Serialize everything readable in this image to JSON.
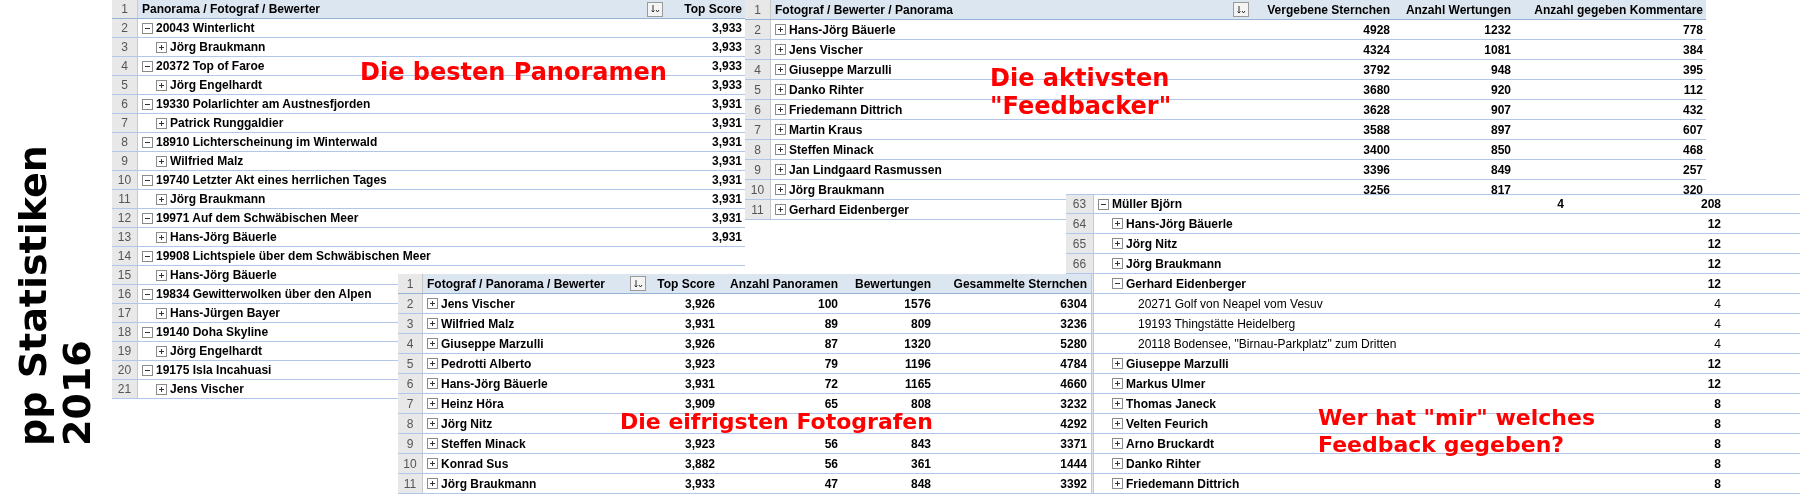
{
  "title": {
    "line_1": "pp Statistiken",
    "line_2": "2016"
  },
  "panorama_table": {
    "header_number": "1",
    "columns": [
      "Panorama / Fotograf / Bewerter",
      "Top Score"
    ],
    "rows": [
      {
        "number": "2",
        "label": "20043 Winterlicht",
        "expanded": true,
        "top_score": "3,933",
        "children": [
          {
            "number": "3",
            "label": "Jörg Braukmann",
            "expanded": false,
            "top_score": "3,933"
          }
        ]
      },
      {
        "number": "4",
        "label": "20372 Top of Faroe",
        "expanded": true,
        "top_score": "3,933",
        "children": [
          {
            "number": "5",
            "label": "Jörg Engelhardt",
            "expanded": false,
            "top_score": "3,933"
          }
        ]
      },
      {
        "number": "6",
        "label": "19330 Polarlichter am Austnesfjorden",
        "expanded": true,
        "top_score": "3,931",
        "children": [
          {
            "number": "7",
            "label": "Patrick Runggaldier",
            "expanded": false,
            "top_score": "3,931"
          }
        ]
      },
      {
        "number": "8",
        "label": "18910 Lichterscheinung im Winterwald",
        "expanded": true,
        "top_score": "3,931",
        "children": [
          {
            "number": "9",
            "label": "Wilfried Malz",
            "expanded": false,
            "top_score": "3,931"
          }
        ]
      },
      {
        "number": "10",
        "label": "19740 Letzter Akt eines herrlichen Tages",
        "expanded": true,
        "top_score": "3,931",
        "children": [
          {
            "number": "11",
            "label": "Jörg Braukmann",
            "expanded": false,
            "top_score": "3,931"
          }
        ]
      },
      {
        "number": "12",
        "label": "19971 Auf dem Schwäbischen Meer",
        "expanded": true,
        "top_score": "3,931",
        "children": [
          {
            "number": "13",
            "label": "Hans-Jörg Bäuerle",
            "expanded": false,
            "top_score": "3,931"
          }
        ]
      },
      {
        "number": "14",
        "label": "19908 Lichtspiele über dem Schwäbischen Meer",
        "expanded": true,
        "children": [
          {
            "number": "15",
            "label": "Hans-Jörg Bäuerle",
            "expanded": false
          }
        ]
      },
      {
        "number": "16",
        "label": "19834 Gewitterwolken über den Alpen",
        "expanded": true,
        "children": [
          {
            "number": "17",
            "label": "Hans-Jürgen Bayer",
            "expanded": false
          }
        ]
      },
      {
        "number": "18",
        "label": "19140 Doha Skyline",
        "expanded": true,
        "children": [
          {
            "number": "19",
            "label": "Jörg Engelhardt",
            "expanded": false
          }
        ]
      },
      {
        "number": "20",
        "label": "19175 Isla Incahuasi",
        "expanded": true,
        "children": [
          {
            "number": "21",
            "label": "Jens Vischer",
            "expanded": false
          }
        ]
      }
    ]
  },
  "feedbacker_table": {
    "header_number": "1",
    "columns": [
      "Fotograf / Bewerter / Panorama",
      "Vergebene Sternchen",
      "Anzahl Wertungen",
      "Anzahl gegeben Kommentare"
    ],
    "rows": [
      {
        "number": "2",
        "label": "Hans-Jörg Bäuerle",
        "expanded": false,
        "stars": "4928",
        "ratings": "1232",
        "comments": "778"
      },
      {
        "number": "3",
        "label": "Jens Vischer",
        "expanded": false,
        "stars": "4324",
        "ratings": "1081",
        "comments": "384"
      },
      {
        "number": "4",
        "label": "Giuseppe Marzulli",
        "expanded": false,
        "stars": "3792",
        "ratings": "948",
        "comments": "395"
      },
      {
        "number": "5",
        "label": "Danko Rihter",
        "expanded": false,
        "stars": "3680",
        "ratings": "920",
        "comments": "112"
      },
      {
        "number": "6",
        "label": "Friedemann Dittrich",
        "expanded": false,
        "stars": "3628",
        "ratings": "907",
        "comments": "432"
      },
      {
        "number": "7",
        "label": "Martin Kraus",
        "expanded": false,
        "stars": "3588",
        "ratings": "897",
        "comments": "607"
      },
      {
        "number": "8",
        "label": "Steffen Minack",
        "expanded": false,
        "stars": "3400",
        "ratings": "850",
        "comments": "468"
      },
      {
        "number": "9",
        "label": "Jan Lindgaard Rasmussen",
        "expanded": false,
        "stars": "3396",
        "ratings": "849",
        "comments": "257"
      },
      {
        "number": "10",
        "label": "Jörg Braukmann",
        "expanded": false,
        "stars": "3256",
        "ratings": "817",
        "comments": "320"
      },
      {
        "number": "11",
        "label": "Gerhard Eidenberger",
        "expanded": false
      }
    ]
  },
  "feedback_table": {
    "rows": [
      {
        "number": "63",
        "label": "Müller Björn",
        "expanded": true,
        "column_1": "4",
        "column_2": "208",
        "children": [
          {
            "number": "64",
            "label": "Hans-Jörg Bäuerle",
            "expanded": false,
            "column_2": "12"
          },
          {
            "number": "65",
            "label": "Jörg Nitz",
            "expanded": false,
            "column_2": "12"
          },
          {
            "number": "66",
            "label": "Jörg Braukmann",
            "expanded": false,
            "column_2": "12"
          },
          {
            "label": "Gerhard Eidenberger",
            "expanded": true,
            "column_2": "12",
            "children": [
              {
                "label": "20271 Golf von Neapel vom Vesuv",
                "column_2": "4"
              },
              {
                "label": "19193 Thingstätte Heidelberg",
                "column_2": "4"
              },
              {
                "label": "20118 Bodensee, \"Birnau-Parkplatz\" zum Dritten",
                "column_2": "4"
              }
            ]
          },
          {
            "label": "Giuseppe Marzulli",
            "expanded": false,
            "column_2": "12"
          },
          {
            "label": "Markus Ulmer",
            "expanded": false,
            "column_2": "12"
          },
          {
            "label": "Thomas Janeck",
            "expanded": false,
            "column_2": "8"
          },
          {
            "label": "Velten Feurich",
            "expanded": false,
            "column_2": "8"
          },
          {
            "label": "Arno Bruckardt",
            "expanded": false,
            "column_2": "8"
          },
          {
            "label": "Danko Rihter",
            "expanded": false,
            "column_2": "8"
          },
          {
            "label": "Friedemann Dittrich",
            "expanded": false,
            "column_2": "8"
          }
        ]
      }
    ]
  },
  "photographer_table": {
    "header_number": "1",
    "columns": [
      "Fotograf / Panorama / Bewerter",
      "Top Score",
      "Anzahl Panoramen",
      "Bewertungen",
      "Gesammelte Sternchen"
    ],
    "rows": [
      {
        "number": "2",
        "label": "Jens Vischer",
        "expanded": false,
        "top_score": "3,926",
        "panoramas": "100",
        "ratings": "1576",
        "stars": "6304"
      },
      {
        "number": "3",
        "label": "Wilfried Malz",
        "expanded": false,
        "top_score": "3,931",
        "panoramas": "89",
        "ratings": "809",
        "stars": "3236"
      },
      {
        "number": "4",
        "label": "Giuseppe Marzulli",
        "expanded": false,
        "top_score": "3,926",
        "panoramas": "87",
        "ratings": "1320",
        "stars": "5280"
      },
      {
        "number": "5",
        "label": "Pedrotti Alberto",
        "expanded": false,
        "top_score": "3,923",
        "panoramas": "79",
        "ratings": "1196",
        "stars": "4784"
      },
      {
        "number": "6",
        "label": "Hans-Jörg Bäuerle",
        "expanded": false,
        "top_score": "3,931",
        "panoramas": "72",
        "ratings": "1165",
        "stars": "4660"
      },
      {
        "number": "7",
        "label": "Heinz Höra",
        "expanded": false,
        "top_score": "3,909",
        "panoramas": "65",
        "ratings": "808",
        "stars": "3232"
      },
      {
        "number": "8",
        "label": "Jörg Nitz",
        "expanded": false,
        "stars": "4292"
      },
      {
        "number": "9",
        "label": "Steffen Minack",
        "expanded": false,
        "top_score": "3,923",
        "panoramas": "56",
        "ratings": "843",
        "stars": "3371"
      },
      {
        "number": "10",
        "label": "Konrad Sus",
        "expanded": false,
        "top_score": "3,882",
        "panoramas": "56",
        "ratings": "361",
        "stars": "1444"
      },
      {
        "number": "11",
        "label": "Jörg Braukmann",
        "expanded": false,
        "top_score": "3,933",
        "panoramas": "47",
        "ratings": "848",
        "stars": "3392"
      }
    ]
  },
  "annotations": [
    {
      "text": "Die besten Panoramen"
    },
    {
      "text": "Die aktivsten \"Feedbacker\""
    },
    {
      "text": "Die eifrigsten Fotografen"
    },
    {
      "text": "Wer hat \"mir\" welches Feedback gegeben?"
    }
  ]
}
